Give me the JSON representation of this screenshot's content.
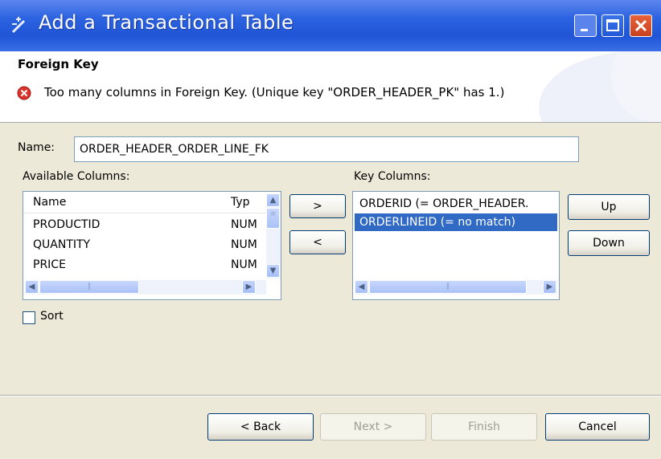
{
  "window": {
    "title": "Add a Transactional Table"
  },
  "header": {
    "section_title": "Foreign Key",
    "error_message": "Too many columns in Foreign Key.  (Unique key \"ORDER_HEADER_PK\" has 1.)"
  },
  "form": {
    "name_label": "Name:",
    "name_value": "ORDER_HEADER_ORDER_LINE_FK",
    "available_label": "Available Columns:",
    "key_label": "Key Columns:",
    "sort_label": "Sort",
    "sort_checked": false
  },
  "available_table": {
    "columns": [
      "Name",
      "Typ"
    ],
    "rows": [
      {
        "name": "PRODUCTID",
        "type": "NUM"
      },
      {
        "name": "QUANTITY",
        "type": "NUM"
      },
      {
        "name": "PRICE",
        "type": "NUM"
      }
    ]
  },
  "key_columns": {
    "items": [
      {
        "label": "ORDERID (= ORDER_HEADER.",
        "selected": false
      },
      {
        "label": "ORDERLINEID (= no match)",
        "selected": true
      }
    ]
  },
  "buttons": {
    "add": ">",
    "remove": "<",
    "up": "Up",
    "down": "Down",
    "back": "< Back",
    "next": "Next >",
    "finish": "Finish",
    "cancel": "Cancel"
  },
  "colors": {
    "title_bar": "#2c63e0",
    "selection": "#316ac5",
    "error": "#d9342b"
  },
  "icons": {
    "app": "wizard-icon",
    "error": "error-icon"
  }
}
